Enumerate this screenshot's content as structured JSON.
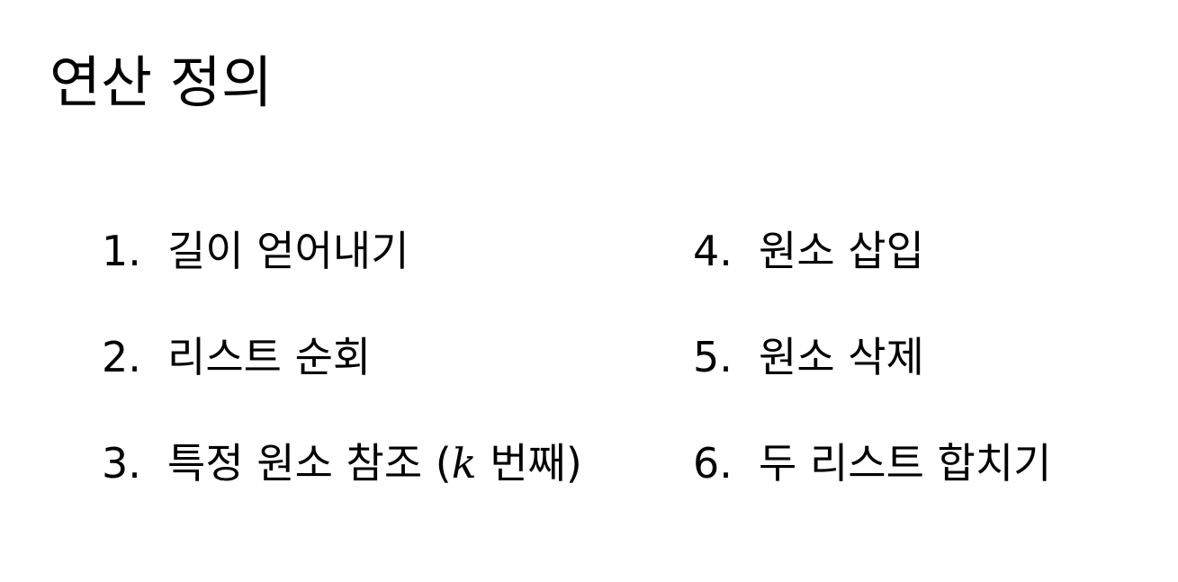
{
  "slide": {
    "title": "연산 정의",
    "left_items": [
      {
        "number": "1.",
        "text": "길이 얻어내기"
      },
      {
        "number": "2.",
        "text": "리스트 순회"
      },
      {
        "number": "3.",
        "text_before": "특정 원소 참조 (",
        "variable": "k",
        "text_after": " 번째)"
      }
    ],
    "right_items": [
      {
        "number": "4.",
        "text": "원소 삽입"
      },
      {
        "number": "5.",
        "text": "원소 삭제"
      },
      {
        "number": "6.",
        "text": "두 리스트 합치기"
      }
    ]
  }
}
